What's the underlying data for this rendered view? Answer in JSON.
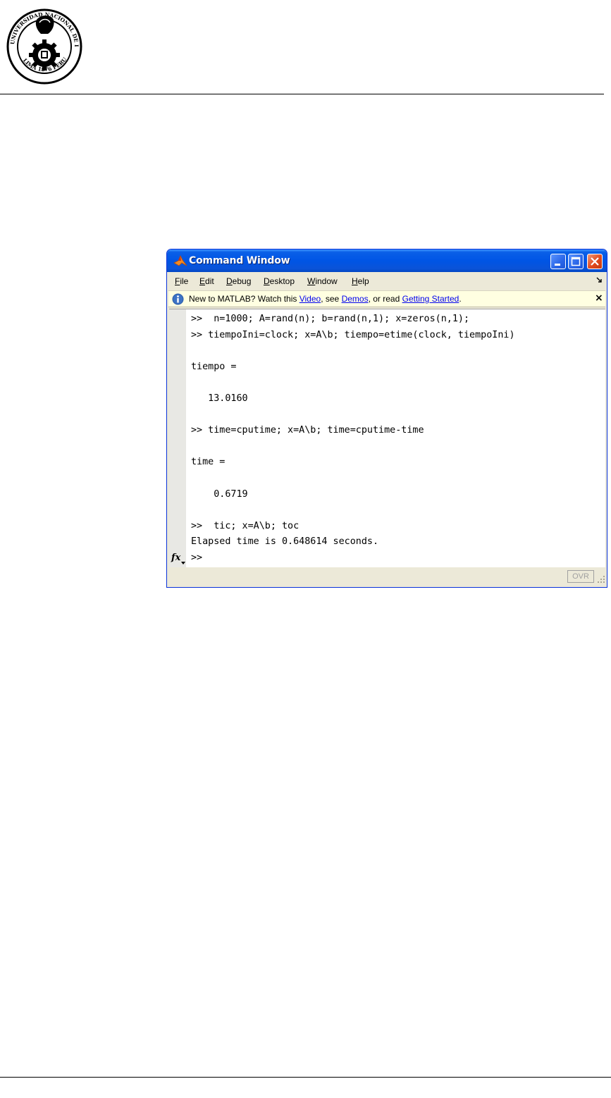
{
  "document": {
    "seal_text": "UNIVERSIDAD NACIONAL DE INGENIERIA · LIMA 1876 PERU"
  },
  "window": {
    "title": "Command Window",
    "icon": "matlab-logo-icon",
    "controls": [
      "minimize-icon",
      "maximize-icon",
      "close-icon"
    ]
  },
  "menu": {
    "items": [
      {
        "label": "File"
      },
      {
        "label": "Edit"
      },
      {
        "label": "Debug"
      },
      {
        "label": "Desktop"
      },
      {
        "label": "Window"
      },
      {
        "label": "Help"
      }
    ],
    "dock_icon": "undock-arrow-icon"
  },
  "infobar": {
    "prefix": "New to MATLAB? Watch this ",
    "video_link": "Video",
    "middle": ", see ",
    "demos_link": "Demos",
    "or_read": ", or read ",
    "getting_started_link": "Getting Started",
    "suffix": ".",
    "close_label": "×"
  },
  "console": {
    "lines": [
      ">>  n=1000; A=rand(n); b=rand(n,1); x=zeros(n,1);",
      ">> tiempoIni=clock; x=A\\b; tiempo=etime(clock, tiempoIni)",
      "",
      "tiempo =",
      "",
      "   13.0160",
      "",
      ">> time=cputime; x=A\\b; time=cputime-time",
      "",
      "time =",
      "",
      "    0.6719",
      "",
      ">>  tic; x=A\\b; toc",
      "Elapsed time is 0.648614 seconds.",
      ">> "
    ],
    "fx_label": "fx"
  },
  "status": {
    "ovr_label": "OVR"
  }
}
